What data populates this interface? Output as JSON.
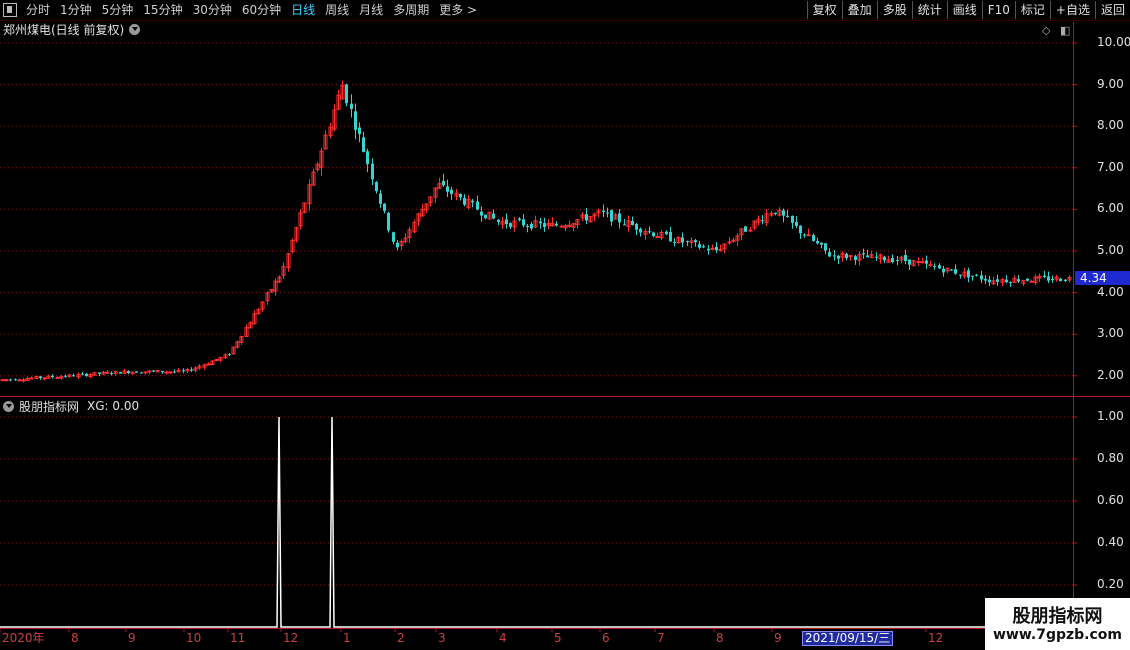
{
  "toolbar": {
    "periods": [
      "分时",
      "1分钟",
      "5分钟",
      "15分钟",
      "30分钟",
      "60分钟",
      "日线",
      "周线",
      "月线",
      "多周期",
      "更多 >"
    ],
    "active_period": "日线",
    "right_buttons": [
      "复权",
      "叠加",
      "多股",
      "统计",
      "画线",
      "F10",
      "标记",
      "+自选",
      "返回"
    ]
  },
  "price_panel": {
    "title": "郑州煤电(日线 前复权)",
    "y_ticks": [
      "10.00",
      "9.00",
      "8.00",
      "7.00",
      "6.00",
      "5.00",
      "4.00",
      "3.00",
      "2.00"
    ],
    "last_price": "4.34"
  },
  "indicator_panel": {
    "name": "股朋指标网",
    "value_text": "XG: 0.00",
    "y_ticks": [
      "1.00",
      "0.80",
      "0.60",
      "0.40",
      "0.20"
    ]
  },
  "x_axis": {
    "labels": [
      "2020年",
      "8",
      "9",
      "10",
      "11",
      "12",
      "1",
      "2",
      "3",
      "4",
      "5",
      "6",
      "7",
      "8",
      "9",
      "11",
      "12"
    ],
    "cursor_date": "2021/09/15/三"
  },
  "watermark": {
    "line1": "股朋指标网",
    "line2": "www.7gpzb.com"
  },
  "colors": {
    "up": "#ff3030",
    "down": "#38d2d2",
    "grid": "#8a1a1a",
    "axis": "#b01818",
    "signal": "#ffffff",
    "last_price_bg": "#1e2ad0"
  },
  "chart_data": [
    {
      "type": "candlestick",
      "title": "郑州煤电(日线 前复权)",
      "x_range": [
        "2020-07",
        "2022-01"
      ],
      "ylim": [
        1.6,
        10.2
      ],
      "approximate_close_path": [
        {
          "month": "2020-07",
          "close": 1.9
        },
        {
          "month": "2020-08",
          "close": 2.0
        },
        {
          "month": "2020-09",
          "close": 2.1
        },
        {
          "month": "2020-10",
          "close": 2.1
        },
        {
          "month": "2020-11",
          "close": 2.5
        },
        {
          "month": "2020-12",
          "close": 4.5
        },
        {
          "month": "2021-01",
          "close": 9.0
        },
        {
          "month": "2021-02",
          "close": 5.0
        },
        {
          "month": "2021-03",
          "close": 6.6
        },
        {
          "month": "2021-04",
          "close": 5.7
        },
        {
          "month": "2021-05",
          "close": 5.6
        },
        {
          "month": "2021-06",
          "close": 5.9
        },
        {
          "month": "2021-07",
          "close": 5.4
        },
        {
          "month": "2021-08",
          "close": 5.0
        },
        {
          "month": "2021-09",
          "close": 6.0
        },
        {
          "month": "2021-10",
          "close": 4.9
        },
        {
          "month": "2021-11",
          "close": 4.8
        },
        {
          "month": "2021-12",
          "close": 4.3
        }
      ],
      "last_price": 4.34
    },
    {
      "type": "line",
      "series": [
        {
          "name": "XG",
          "signal_dates": [
            "2020-12",
            "2021-01"
          ],
          "signal_value": 1.0,
          "base_value": 0.0
        }
      ],
      "ylim": [
        0,
        1.05
      ]
    }
  ]
}
